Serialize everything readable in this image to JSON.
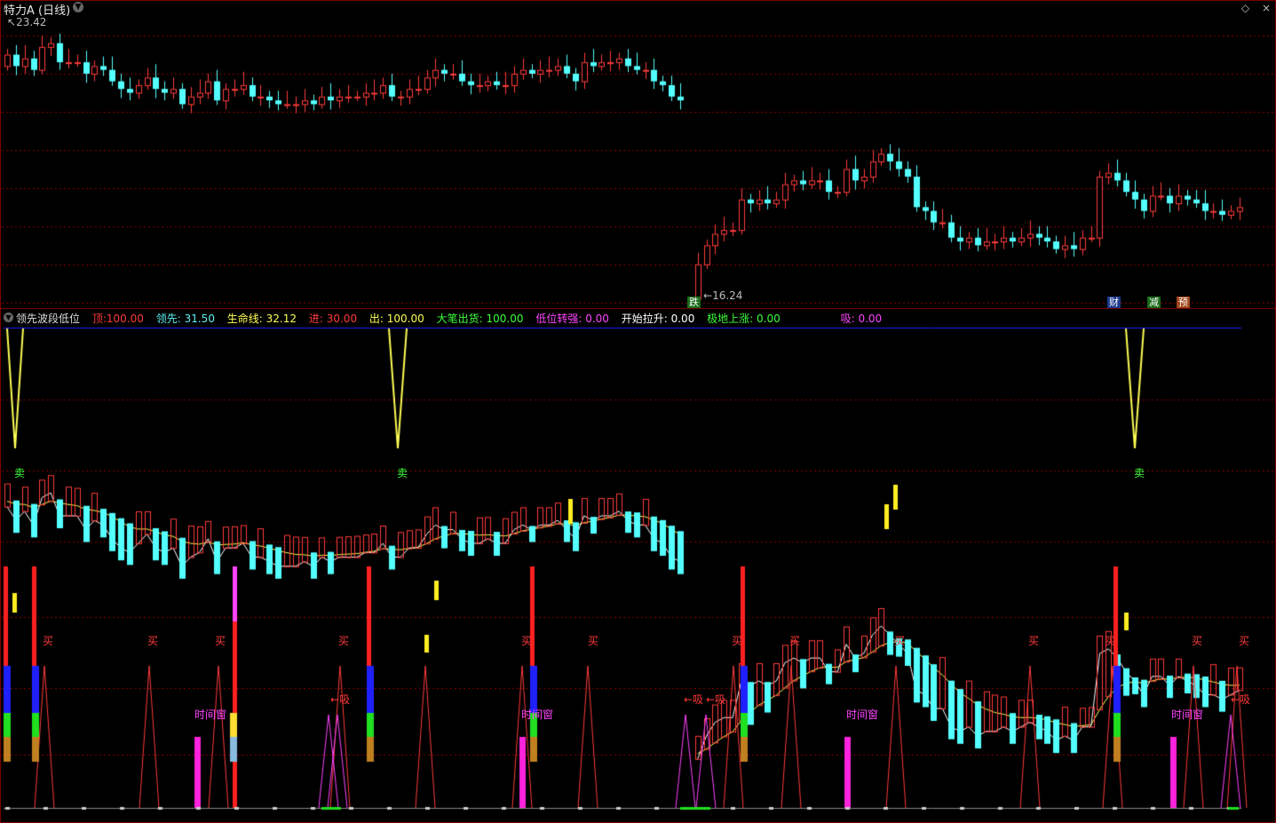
{
  "window": {
    "title": "特力A (日线)",
    "controls": [
      "◇",
      "×"
    ]
  },
  "price_panel": {
    "high_label": "23.42",
    "low_label": "16.24",
    "events": [
      {
        "label": "跌",
        "color": "#ffffff",
        "bg": "#1a6a1a"
      },
      {
        "label": "财",
        "color": "#ffffff",
        "bg": "#1a3a8a"
      },
      {
        "label": "减",
        "color": "#ffffff",
        "bg": "#1a6a1a"
      },
      {
        "label": "预",
        "color": "#ffffff",
        "bg": "#a0441a"
      }
    ]
  },
  "indicator": {
    "name": "领先波段低位",
    "values": [
      {
        "label": "顶:",
        "value": "100.00",
        "color": "#ff3a3a"
      },
      {
        "label": "领先:",
        "value": "31.50",
        "color": "#5ff0f0"
      },
      {
        "label": "生命线:",
        "value": "32.12",
        "color": "#ffff55"
      },
      {
        "label": "进:",
        "value": "30.00",
        "color": "#ff3a3a"
      },
      {
        "label": "出:",
        "value": "100.00",
        "color": "#ffff55"
      },
      {
        "label": "大笔出货:",
        "value": "100.00",
        "color": "#3aff3a"
      },
      {
        "label": "低位转强:",
        "value": "0.00",
        "color": "#ff44ff"
      },
      {
        "label": "开始拉升:",
        "value": "0.00",
        "color": "#ffffff"
      },
      {
        "label": "极地上涨:",
        "value": "0.00",
        "color": "#3aff3a"
      },
      {
        "label": "吸:",
        "value": "0.00",
        "color": "#ff44ff"
      }
    ],
    "signal_labels": {
      "sell": "卖",
      "buy": "买",
      "absorb": "←吸",
      "time_window": "时间窗"
    }
  },
  "colors": {
    "up": "#ff3b3b",
    "down": "#54ffff",
    "grid": "#8b0000",
    "divider": "#8b0000",
    "life_line": "#ffff55",
    "lead_line": "#ffffff",
    "top_line": "#2020ff"
  },
  "chart_data": {
    "type": "candlestick",
    "ylim": [
      16.0,
      23.8
    ],
    "high": 23.42,
    "low": 16.24,
    "close": [
      22.6,
      22.3,
      22.5,
      22.2,
      22.8,
      22.9,
      22.4,
      22.4,
      22.4,
      22.1,
      22.3,
      22.2,
      21.9,
      21.7,
      21.6,
      21.8,
      22.0,
      21.7,
      21.6,
      21.7,
      21.3,
      21.5,
      21.6,
      21.9,
      21.4,
      21.7,
      21.7,
      21.8,
      21.5,
      21.5,
      21.4,
      21.3,
      21.3,
      21.3,
      21.4,
      21.3,
      21.5,
      21.4,
      21.5,
      21.5,
      21.5,
      21.6,
      21.6,
      21.8,
      21.5,
      21.5,
      21.7,
      21.7,
      22.0,
      22.2,
      22.1,
      22.1,
      21.9,
      21.8,
      21.8,
      21.9,
      21.8,
      21.8,
      22.1,
      22.2,
      22.1,
      22.2,
      22.2,
      22.3,
      22.1,
      21.9,
      22.4,
      22.3,
      22.4,
      22.4,
      22.5,
      22.3,
      22.2,
      22.2,
      21.9,
      21.8,
      21.5,
      21.4,
      null,
      17.1,
      17.6,
      17.9,
      18.0,
      18.0,
      18.8,
      18.7,
      18.8,
      18.7,
      18.8,
      19.2,
      19.3,
      19.2,
      19.3,
      19.3,
      19.0,
      19.0,
      19.6,
      19.3,
      19.4,
      19.8,
      20.0,
      19.8,
      19.6,
      19.4,
      18.6,
      18.5,
      18.2,
      18.2,
      17.8,
      17.7,
      17.8,
      17.6,
      17.7,
      17.7,
      17.8,
      17.7,
      17.8,
      17.9,
      17.8,
      17.7,
      17.5,
      17.6,
      17.5,
      17.8,
      17.8,
      19.4,
      19.5,
      19.3,
      19.0,
      18.8,
      18.5,
      18.9,
      18.9,
      18.7,
      18.9,
      18.8,
      18.7,
      18.5,
      18.5,
      18.4,
      18.5,
      18.6
    ]
  }
}
